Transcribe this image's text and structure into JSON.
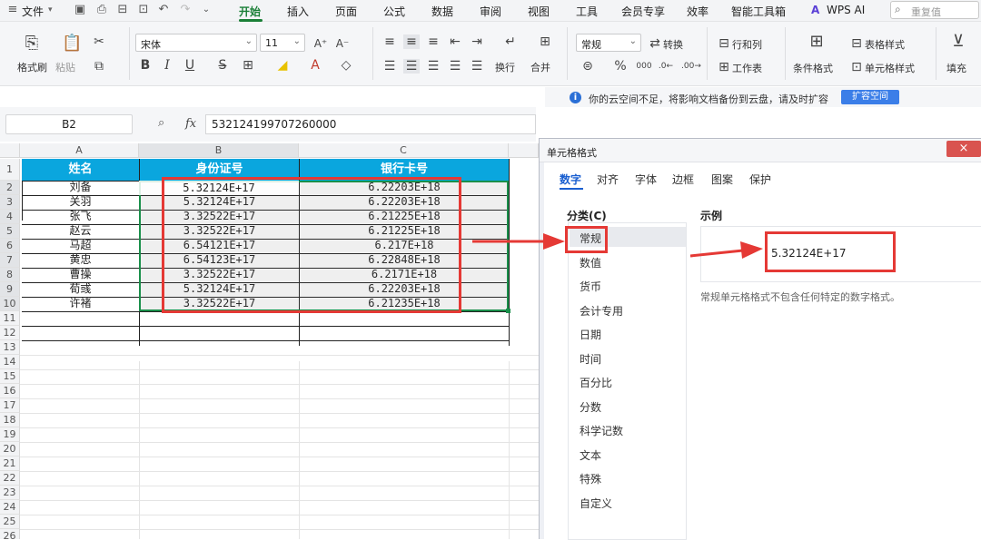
{
  "menu": {
    "file": "文件",
    "tabs": [
      "开始",
      "插入",
      "页面",
      "公式",
      "数据",
      "审阅",
      "视图",
      "工具",
      "会员专享",
      "效率",
      "智能工具箱",
      "WPS AI"
    ],
    "search_placeholder": "重复值"
  },
  "ribbon": {
    "format_painter": "格式刷",
    "paste": "粘贴",
    "font_name": "宋体",
    "font_size": "11",
    "font_grow": "A⁺",
    "font_shrink": "A⁻",
    "bold": "B",
    "italic": "I",
    "underline": "U",
    "wrap": "换行",
    "merge": "合并",
    "number_format": "常规",
    "convert": "转换",
    "percent": "%",
    "rows_cols": "行和列",
    "worksheet": "工作表",
    "cond_format": "条件格式",
    "table_style": "表格样式",
    "cell_style": "单元格样式",
    "fill": "填充"
  },
  "notice": {
    "text": "你的云空间不足，将影响文档备份到云盘，请及时扩容",
    "button": "扩容空间"
  },
  "formula_bar": {
    "cell_ref": "B2",
    "fx": "fx",
    "value": "532124199707260000"
  },
  "sheet": {
    "columns": [
      "A",
      "B",
      "C"
    ],
    "row_numbers": [
      "1",
      "2",
      "3",
      "4",
      "5",
      "6",
      "7",
      "8",
      "9",
      "10",
      "11",
      "12",
      "13",
      "14",
      "15",
      "16",
      "17",
      "18",
      "19",
      "20",
      "21",
      "22",
      "23",
      "24",
      "25",
      "26"
    ],
    "headers": [
      "姓名",
      "身份证号",
      "银行卡号"
    ],
    "rows": [
      [
        "刘备",
        "5.32124E+17",
        "6.22203E+18"
      ],
      [
        "关羽",
        "5.32124E+17",
        "6.22203E+18"
      ],
      [
        "张飞",
        "3.32522E+17",
        "6.21225E+18"
      ],
      [
        "赵云",
        "3.32522E+17",
        "6.21225E+18"
      ],
      [
        "马超",
        "6.54121E+17",
        "6.217E+18"
      ],
      [
        "黄忠",
        "6.54123E+17",
        "6.22848E+18"
      ],
      [
        "曹操",
        "3.32522E+17",
        "6.2171E+18"
      ],
      [
        "荀彧",
        "5.32124E+17",
        "6.22203E+18"
      ],
      [
        "许褚",
        "3.32522E+17",
        "6.21235E+18"
      ]
    ]
  },
  "dialog": {
    "title": "单元格格式",
    "close": "×",
    "tabs": [
      "数字",
      "对齐",
      "字体",
      "边框",
      "图案",
      "保护"
    ],
    "category_label": "分类(C)",
    "categories": [
      "常规",
      "数值",
      "货币",
      "会计专用",
      "日期",
      "时间",
      "百分比",
      "分数",
      "科学记数",
      "文本",
      "特殊",
      "自定义"
    ],
    "sample_label": "示例",
    "sample_value": "5.32124E+17",
    "description": "常规单元格格式不包含任何特定的数字格式。"
  },
  "colors": {
    "header_fill": "#0aa6de",
    "accent_green": "#1a7f37",
    "highlight_red": "#e53935"
  }
}
